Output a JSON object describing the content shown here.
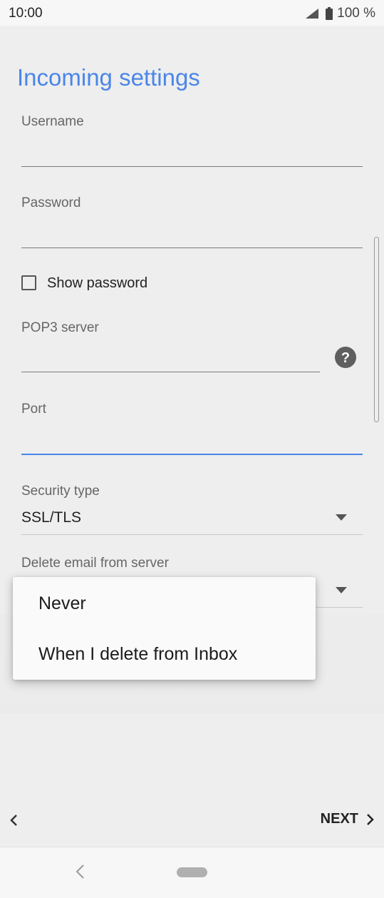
{
  "status_bar": {
    "time": "10:00",
    "battery": "100 %"
  },
  "title": "Incoming settings",
  "fields": {
    "username": {
      "label": "Username",
      "value": ""
    },
    "password": {
      "label": "Password",
      "value": ""
    },
    "show_password": {
      "label": "Show password",
      "checked": false
    },
    "pop3_server": {
      "label": "POP3 server",
      "value": ""
    },
    "port": {
      "label": "Port",
      "value": ""
    },
    "security_type": {
      "label": "Security type",
      "value": "SSL/TLS"
    },
    "delete_email": {
      "label": "Delete email from server"
    }
  },
  "menu": {
    "items": [
      {
        "label": "Never"
      },
      {
        "label": "When I delete from Inbox"
      }
    ]
  },
  "footer": {
    "next_label": "NEXT"
  },
  "colors": {
    "accent": "#4a86e8",
    "background": "#eeeeee"
  }
}
